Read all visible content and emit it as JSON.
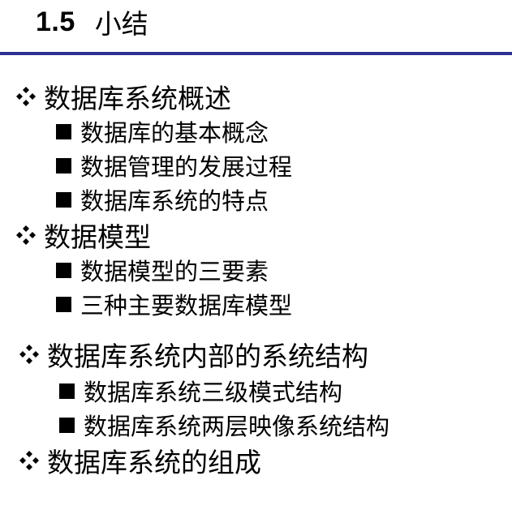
{
  "header": {
    "number": "1.5",
    "title": "小结"
  },
  "sections": [
    {
      "label": "数据库系统概述",
      "items": [
        "数据库的基本概念",
        "数据管理的发展过程",
        "数据库系统的特点"
      ]
    },
    {
      "label": "数据模型",
      "items": [
        "数据模型的三要素",
        "三种主要数据库模型"
      ]
    },
    {
      "label": "数据库系统内部的系统结构",
      "items": [
        "数据库系统三级模式结构",
        "数据库系统两层映像系统结构"
      ]
    },
    {
      "label": "数据库系统的组成",
      "items": []
    }
  ],
  "colors": {
    "rule": "#2e3192",
    "text": "#000000"
  },
  "icons": {
    "section_bullet": "four-diamond-bullet-icon",
    "item_bullet": "black-square-bullet-icon"
  }
}
